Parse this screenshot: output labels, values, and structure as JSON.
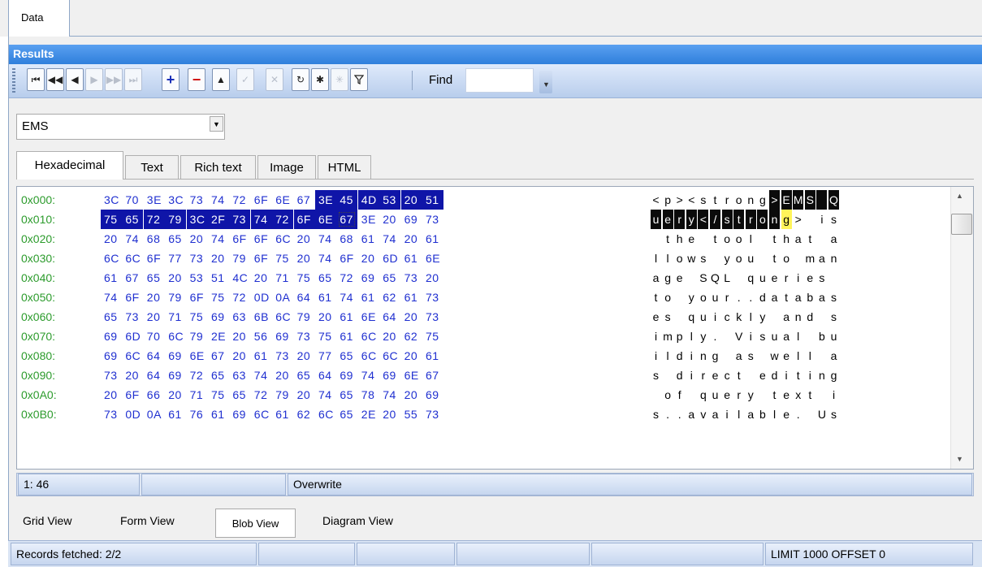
{
  "tabs": {
    "data": "Data"
  },
  "results": {
    "title": "Results"
  },
  "toolbar": {
    "buttons": [
      "first",
      "prior-page",
      "prior",
      "next",
      "next-page",
      "last",
      "insert",
      "delete",
      "edit",
      "post",
      "cancel",
      "refresh",
      "apply",
      "cancel-updates",
      "filter"
    ],
    "find_label": "Find",
    "find_value": ""
  },
  "encoding": {
    "value": "EMS"
  },
  "view_tabs": [
    "Hexadecimal",
    "Text",
    "Rich text",
    "Image",
    "HTML"
  ],
  "hex": {
    "rows": [
      {
        "addr": "0x000:",
        "bytes": [
          "3C",
          "70",
          "3E",
          "3C",
          "73",
          "74",
          "72",
          "6F",
          "6E",
          "67",
          "3E",
          "45",
          "4D",
          "53",
          "20",
          "51"
        ],
        "text": "<p><strong>EMS Q"
      },
      {
        "addr": "0x010:",
        "bytes": [
          "75",
          "65",
          "72",
          "79",
          "3C",
          "2F",
          "73",
          "74",
          "72",
          "6F",
          "6E",
          "67",
          "3E",
          "20",
          "69",
          "73"
        ],
        "text": "uery</strong> is"
      },
      {
        "addr": "0x020:",
        "bytes": [
          "20",
          "74",
          "68",
          "65",
          "20",
          "74",
          "6F",
          "6F",
          "6C",
          "20",
          "74",
          "68",
          "61",
          "74",
          "20",
          "61"
        ],
        "text": " the tool that a"
      },
      {
        "addr": "0x030:",
        "bytes": [
          "6C",
          "6C",
          "6F",
          "77",
          "73",
          "20",
          "79",
          "6F",
          "75",
          "20",
          "74",
          "6F",
          "20",
          "6D",
          "61",
          "6E"
        ],
        "text": "llows you to man"
      },
      {
        "addr": "0x040:",
        "bytes": [
          "61",
          "67",
          "65",
          "20",
          "53",
          "51",
          "4C",
          "20",
          "71",
          "75",
          "65",
          "72",
          "69",
          "65",
          "73",
          "20"
        ],
        "text": "age SQL queries "
      },
      {
        "addr": "0x050:",
        "bytes": [
          "74",
          "6F",
          "20",
          "79",
          "6F",
          "75",
          "72",
          "0D",
          "0A",
          "64",
          "61",
          "74",
          "61",
          "62",
          "61",
          "73"
        ],
        "text": "to your..databas"
      },
      {
        "addr": "0x060:",
        "bytes": [
          "65",
          "73",
          "20",
          "71",
          "75",
          "69",
          "63",
          "6B",
          "6C",
          "79",
          "20",
          "61",
          "6E",
          "64",
          "20",
          "73"
        ],
        "text": "es quickly and s"
      },
      {
        "addr": "0x070:",
        "bytes": [
          "69",
          "6D",
          "70",
          "6C",
          "79",
          "2E",
          "20",
          "56",
          "69",
          "73",
          "75",
          "61",
          "6C",
          "20",
          "62",
          "75"
        ],
        "text": "imply. Visual bu"
      },
      {
        "addr": "0x080:",
        "bytes": [
          "69",
          "6C",
          "64",
          "69",
          "6E",
          "67",
          "20",
          "61",
          "73",
          "20",
          "77",
          "65",
          "6C",
          "6C",
          "20",
          "61"
        ],
        "text": "ilding as well a"
      },
      {
        "addr": "0x090:",
        "bytes": [
          "73",
          "20",
          "64",
          "69",
          "72",
          "65",
          "63",
          "74",
          "20",
          "65",
          "64",
          "69",
          "74",
          "69",
          "6E",
          "67"
        ],
        "text": "s direct editing"
      },
      {
        "addr": "0x0A0:",
        "bytes": [
          "20",
          "6F",
          "66",
          "20",
          "71",
          "75",
          "65",
          "72",
          "79",
          "20",
          "74",
          "65",
          "78",
          "74",
          "20",
          "69"
        ],
        "text": " of query text i"
      },
      {
        "addr": "0x0B0:",
        "bytes": [
          "73",
          "0D",
          "0A",
          "61",
          "76",
          "61",
          "69",
          "6C",
          "61",
          "62",
          "6C",
          "65",
          "2E",
          "20",
          "55",
          "73"
        ],
        "text": "s..available. Us"
      }
    ]
  },
  "hex_status": {
    "position": "1: 46",
    "mode": "Overwrite"
  },
  "views": [
    "Grid View",
    "Form View",
    "Blob View",
    "Diagram View"
  ],
  "status": {
    "records": "Records fetched: 2/2",
    "limit": "LIMIT 1000 OFFSET 0"
  }
}
